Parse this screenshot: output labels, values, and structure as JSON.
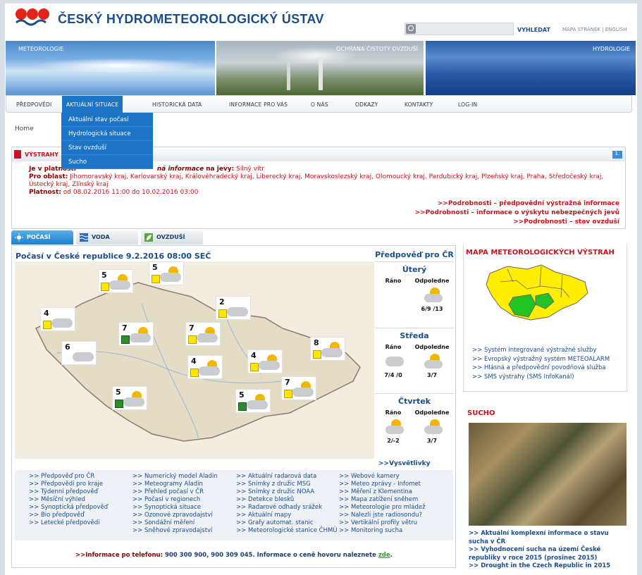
{
  "header": {
    "site_title": "ČESKÝ HYDROMETEOROLOGICKÝ ÚSTAV",
    "search_label": "VYHLEDAT",
    "search_placeholder": "",
    "util_links": "MAPA STRÁNEK  |  ENGLISH"
  },
  "banner": {
    "left_label": "METEOROLOGIE",
    "center_label": "OCHRANA ČISTOTY OVZDUŠÍ",
    "right_label": "HYDROLOGIE"
  },
  "nav": {
    "items": [
      "PŘEDPOVĚDI",
      "AKTUÁLNÍ SITUACE",
      "HISTORICKÁ DATA",
      "INFORMACE PRO VÁS",
      "O NÁS",
      "ODKAZY",
      "KONTAKTY",
      "LOG-IN"
    ],
    "dropdown": [
      "Aktuální stav počasí",
      "Hydrologická situace",
      "Stav ovzduší",
      "Sucho"
    ]
  },
  "breadcrumb": "Home",
  "warnings": {
    "title": "VÝSTRAHY",
    "badge": "1.",
    "line1_prefix": "Je v platnosti",
    "line1_mid": "ná informace",
    "line1_suffix": "na jevy:",
    "line1_value": "Silný vítr",
    "regions_label": "Pro oblast:",
    "regions": "Jihomoravský kraj, Karlovarský kraj, Královéhradecký kraj, Liberecký kraj, Moravskoslezský kraj, Olomoucký kraj, Pardubický kraj, Plzeňský kraj, Praha, Středočeský kraj, Ústecký kraj, Zlínský kraj",
    "validity_label": "Platnost:",
    "validity": "od 08.02.2016 11:00 do 10.02.2016 03:00",
    "links": [
      ">>Podrobnosti – předpovědní výstražná informace",
      ">>Podrobnosti – informace o výskytu nebezpečných jevů",
      ">>Podrobnosti – stav ovzduší"
    ]
  },
  "tabs": [
    "POČASÍ",
    "VODA",
    "OVZDUŠÍ"
  ],
  "weather": {
    "title": "Počasí v České republice 9.2.2016 08:00 SEČ",
    "stations": [
      "5",
      "5",
      "2",
      "4",
      "7",
      "7",
      "6",
      "8",
      "4",
      "4",
      "7",
      "5",
      "5"
    ]
  },
  "forecast": {
    "title": "Předpověď pro ČR",
    "morning": "Ráno",
    "afternoon": "Odpoledne",
    "days": [
      {
        "name": "Úterý",
        "morning": "",
        "afternoon": "6/9 /13"
      },
      {
        "name": "Středa",
        "morning": "7/4 /0",
        "afternoon": "3/7"
      },
      {
        "name": "Čtvrtek",
        "morning": "2/-2",
        "afternoon": "3/7"
      }
    ],
    "legend": ">>Vysvětlivky"
  },
  "link_columns": [
    [
      ">> Předpověď pro ČR",
      ">> Předpovědi pro kraje",
      ">> Týdenní předpověď",
      ">> Měsíční výhled",
      ">> Synoptická předpověď",
      ">> Bio předpověď",
      ">> Letecké předpovědi"
    ],
    [
      ">> Numerický model Aladin",
      ">> Meteogramy Aladin",
      ">> Přehled počasí v ČR",
      ">> Počasí v regionech",
      ">> Synoptická situace",
      ">> Ozonové zpravodajství",
      ">> Sondážní měření",
      ">> Sněhové zpravodajství"
    ],
    [
      ">> Aktuální radarová data",
      ">> Snímky z družic MSG",
      ">> Snímky z družic NOAA",
      ">> Detekce blesků",
      ">> Radarové odhady srážek",
      ">> Aktuální mapy",
      ">> Grafy automat. stanic",
      ">> Meteorologické stanice ČHMÚ"
    ],
    [
      ">> Webové kamery",
      ">> Meteo zprávy - Infomet",
      ">> Měření z Klementina",
      ">> Mapa zatížení sněhem",
      ">> Meteorologie pro mládež",
      ">> Nalezli jste radiosondu?",
      ">> Vertikální profily větru",
      ">> Monitoring sucha"
    ]
  ],
  "phone": {
    "label": ">>Informace po telefonu:",
    "numbers": "900 300 900,   900 309 045.",
    "price": "Informace o ceně hovoru naleznete",
    "link": "zde",
    "end": "."
  },
  "right": {
    "map_title": "MAPA METEOROLOGICKÝCH VÝSTRAH",
    "map_links": [
      ">> Systém integrované výstražné služby",
      ">> Evropský výstražný systém METEOALARM",
      ">> Hlásná a předpovědní povodňová služba",
      ">> SMS výstrahy (SMS InfoKanál)"
    ],
    "sucho_title": "SUCHO",
    "sucho_links": [
      ">> Aktuální komplexní informace o stavu sucha v ČR",
      ">> Vyhodnocení sucha na území České republiky v roce 2015 (prosinec 2015)",
      ">> Drought in the Czech Republic in 2015"
    ]
  },
  "colors": {
    "brand_blue": "#1a4d8a",
    "warning_red": "#c8141e",
    "nav_active": "#1d73c4",
    "alert_yellow": "#ffee00",
    "alert_green": "#22c322"
  }
}
